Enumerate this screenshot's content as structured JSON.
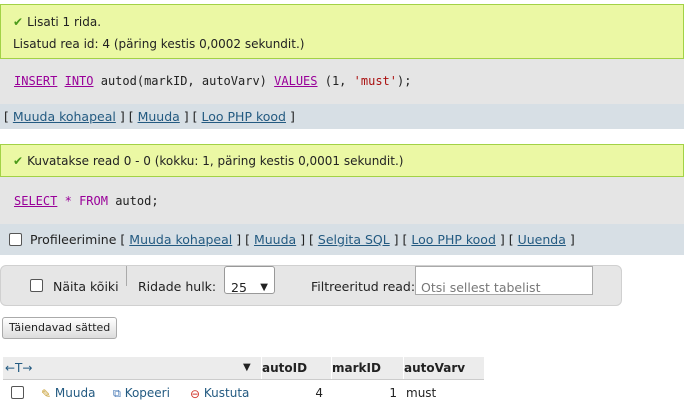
{
  "result1": {
    "title": "Lisati 1 rida.",
    "detail": "Lisatud rea id: 4 (päring kestis 0,0002 sekundit.)"
  },
  "sql1": {
    "kw_insert": "INSERT",
    "kw_into": "INTO",
    "target": "autod(markID, autoVarv)",
    "kw_values": "VALUES",
    "open": "(1, ",
    "str": "'must'",
    "close": ");"
  },
  "toolbar1": {
    "edit_inline": "Muuda kohapeal",
    "edit": "Muuda",
    "create_php": "Loo PHP kood"
  },
  "result2": {
    "title": "Kuvatakse read 0 - 0 (kokku: 1, päring kestis 0,0001 sekundit.)"
  },
  "sql2": {
    "kw_select": "SELECT",
    "star": "*",
    "kw_from": "FROM",
    "rest": "autod;"
  },
  "toolbar2": {
    "profiling": "Profileerimine",
    "edit_inline": "Muuda kohapeal",
    "edit": "Muuda",
    "explain": "Selgita SQL",
    "create_php": "Loo PHP kood",
    "refresh": "Uuenda"
  },
  "navbar": {
    "show_all": "Näita kõiki",
    "rows_label": "Ridade hulk:",
    "rows_value": "25",
    "filter_label": "Filtreeritud read:",
    "filter_placeholder": "Otsi sellest tabelist"
  },
  "extra_options": "Täiendavad sätted",
  "table": {
    "columns": [
      "autoID",
      "markID",
      "autoVarv"
    ],
    "rows": [
      {
        "edit": "Muuda",
        "copy": "Kopeeri",
        "delete": "Kustuta",
        "autoID": "4",
        "markID": "1",
        "autoVarv": "must"
      }
    ]
  },
  "colors": {
    "success_bg": "#ebf8a4",
    "success_border": "#a2d246",
    "sql_bg": "#e5e5e5",
    "toolbar_bg": "#d7dfe5",
    "link": "#235a81",
    "sql_keyword": "#990099",
    "sql_string": "#aa1111"
  }
}
